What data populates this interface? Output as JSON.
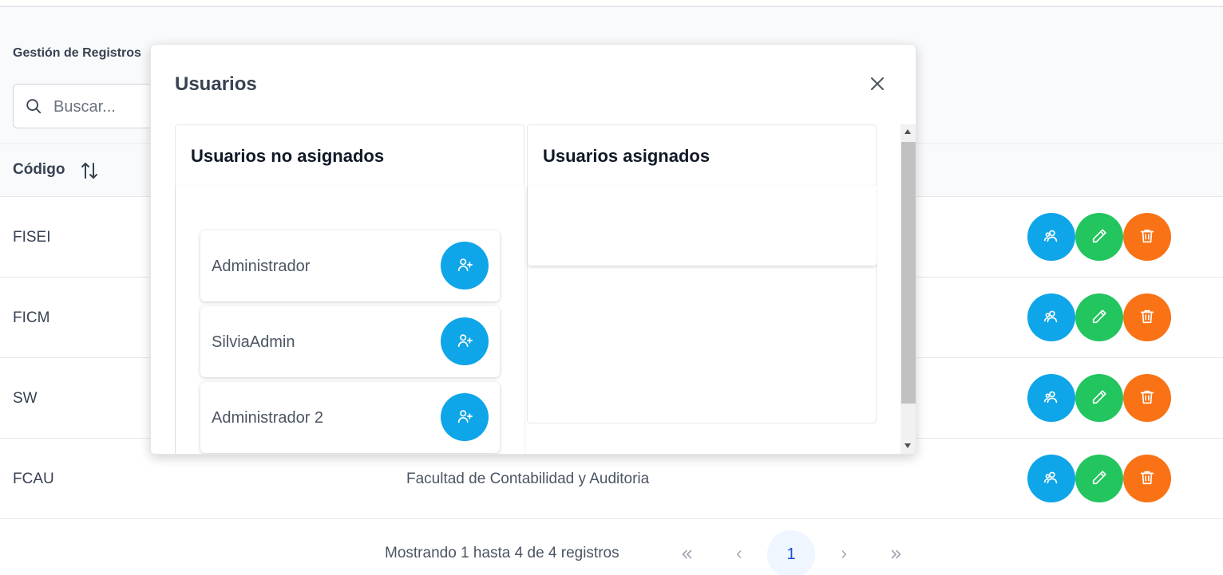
{
  "page": {
    "section_title": "Gestión de Registros",
    "search_placeholder": "Buscar...",
    "search_icon": "search-icon"
  },
  "table": {
    "header_code": "Código",
    "rows": [
      {
        "code": "FISEI",
        "name": ""
      },
      {
        "code": "FICM",
        "name": ""
      },
      {
        "code": "SW",
        "name": ""
      },
      {
        "code": "FCAU",
        "name": "Facultad de Contabilidad y Auditoria"
      }
    ],
    "action_icons": [
      "users-icon",
      "pencil-icon",
      "trash-icon"
    ],
    "colors": {
      "users": "#0ea5e9",
      "edit": "#22c55e",
      "delete": "#f97316"
    }
  },
  "pagination": {
    "info": "Mostrando 1 hasta 4 de 4 registros",
    "first": "«",
    "prev": "‹",
    "current_page": "1",
    "next": "›",
    "last": "»"
  },
  "modal": {
    "title": "Usuarios",
    "close_icon": "close-icon",
    "unassigned_title": "Usuarios no asignados",
    "assigned_title": "Usuarios asignados",
    "unassigned_users": [
      {
        "name": "Administrador"
      },
      {
        "name": "SilviaAdmin"
      },
      {
        "name": "Administrador 2"
      }
    ],
    "assigned_users": [],
    "add_icon": "user-plus-icon"
  }
}
